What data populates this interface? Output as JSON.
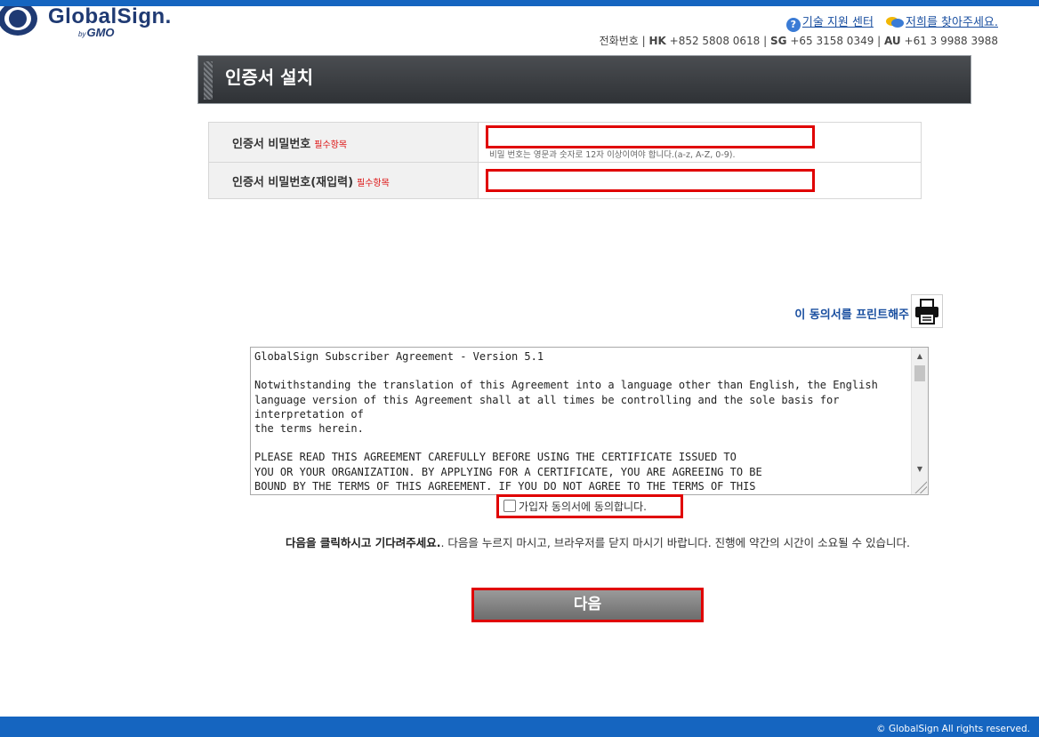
{
  "header": {
    "logo_text": "GlobalSign.",
    "logo_by": "by",
    "logo_gmo": "GMO",
    "tech_support_link": "기술 지원 센터",
    "contact_link": "저희를 찾아주세요.",
    "phone_label": "전화번호",
    "phone_hk_label": "HK",
    "phone_hk": "+852 5808 0618",
    "phone_sg_label": "SG",
    "phone_sg": "+65 3158 0349",
    "phone_au_label": "AU",
    "phone_au": "+61 3 9988 3988"
  },
  "page_title": "인증서 설치",
  "form": {
    "password_label": "인증서 비밀번호",
    "password_required": "필수항목",
    "password_value": "",
    "password_hint": "비밀 번호는 영문과 숫자로 12자 이상이여야 합니다.(a-z, A-Z, 0-9).",
    "password_confirm_label": "인증서 비밀번호(재입력)",
    "password_confirm_required": "필수항목",
    "password_confirm_value": ""
  },
  "print": {
    "link_text": "이 동의서를 프린트해주",
    "icon": "printer-icon"
  },
  "agreement": {
    "text": "GlobalSign Subscriber Agreement - Version 5.1\n\nNotwithstanding the translation of this Agreement into a language other than English, the English language version of this Agreement shall at all times be controlling and the sole basis for interpretation of\nthe terms herein.\n\nPLEASE READ THIS AGREEMENT CAREFULLY BEFORE USING THE CERTIFICATE ISSUED TO\nYOU OR YOUR ORGANIZATION. BY APPLYING FOR A CERTIFICATE, YOU ARE AGREEING TO BE\nBOUND BY THE TERMS OF THIS AGREEMENT. IF YOU DO NOT AGREE TO THE TERMS OF THIS",
    "agree_label": "가입자 동의서에 동의합니다.",
    "agree_checked": false
  },
  "notice": {
    "bold": "다음을 클릭하시고 기다려주세요.",
    "rest": ". 다음을 누르지 마시고, 브라우저를 닫지 마시기 바랍니다. 진행에 약간의 시간이 소요될 수 있습니다."
  },
  "next_button": "다음",
  "footer": {
    "copyright": "© GlobalSign All rights reserved."
  },
  "colors": {
    "brand_blue": "#1565c0",
    "highlight_red": "#e00000",
    "title_bar": "#3a3d41"
  }
}
